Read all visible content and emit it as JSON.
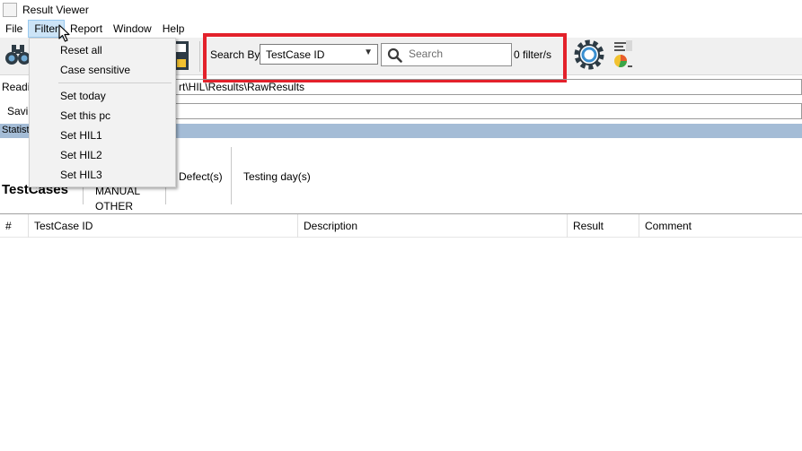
{
  "window": {
    "title": "Result Viewer"
  },
  "menubar": {
    "items": [
      "File",
      "Filter",
      "Report",
      "Window",
      "Help"
    ]
  },
  "filter_menu": {
    "items": [
      "Reset all",
      "Case sensitive",
      "Set today",
      "Set this pc",
      "Set HIL1",
      "Set HIL2",
      "Set HIL3"
    ]
  },
  "toolbar": {
    "search_by_label": "Search By:",
    "search_by_value": "TestCase ID",
    "search_placeholder": "Search",
    "filter_count": "0 filter/s",
    "icons": [
      "binoculars-icon",
      "save-icon",
      "settings-gear-icon",
      "report-chart-icon",
      "search-icon"
    ],
    "highlight_color": "#e3212b"
  },
  "reading": {
    "label": "Readi",
    "path": "rt\\HIL\\Results\\RawResults"
  },
  "saving": {
    "label": "Savi"
  },
  "statistics": {
    "label": "Statist"
  },
  "testcases": {
    "title": "TestCases",
    "types": [
      "MANUAL",
      "OTHER"
    ],
    "defects_label": "Defect(s)",
    "testing_days_label": "Testing day(s)"
  },
  "table": {
    "columns": [
      "#",
      "TestCase ID",
      "Description",
      "Result",
      "Comment"
    ]
  },
  "colors": {
    "stats_bar": "#a4bcd6",
    "menu_active": "#cce4f7"
  }
}
